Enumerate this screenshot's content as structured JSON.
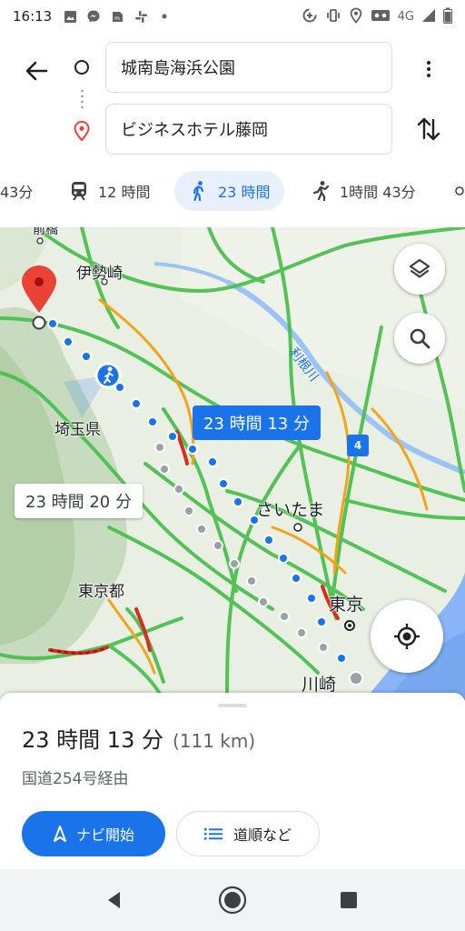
{
  "status_bar": {
    "time": "16:13",
    "network": "4G",
    "left_icons": [
      "image-icon",
      "messenger-icon",
      "sim-icon",
      "slack-icon",
      "dot-icon"
    ],
    "right_icons": [
      "data-saver-icon",
      "vibrate-icon",
      "location-icon",
      "voicemail-icon",
      "signal-icon",
      "battery-icon"
    ]
  },
  "search": {
    "start": "城南島海浜公園",
    "destination": "ビジネスホテル藤岡"
  },
  "modes": [
    {
      "name": "drive",
      "label": "43分",
      "icon": "car-icon",
      "active": false
    },
    {
      "name": "transit",
      "label": "12 時間",
      "icon": "train-icon",
      "active": false
    },
    {
      "name": "walk",
      "label": "23 時間",
      "icon": "walk-icon",
      "active": true
    },
    {
      "name": "ride",
      "label": "1時間 43分",
      "icon": "rideshare-icon",
      "active": false
    }
  ],
  "map": {
    "labels": {
      "top_town": "伊勢崎",
      "saitama_pref": "埼玉県",
      "tokyo_pref": "東京都",
      "saitama_city": "さいたま",
      "tokyo": "東京",
      "kawasaki": "川崎",
      "tone_river": "利根川",
      "route_num": "4",
      "top_edge": "前橋"
    },
    "callouts": {
      "selected": "23 時間 13 分",
      "alternative": "23 時間 20 分"
    }
  },
  "sheet": {
    "duration": "23 時間 13 分",
    "distance": "(111 km)",
    "via": "国道254号経由",
    "start_label": "ナビ開始",
    "steps_label": "道順など"
  },
  "colors": {
    "accent": "#1a73e8",
    "route_alt": "#9aa0a6",
    "traffic_green": "#34c84a",
    "traffic_orange": "#f4a31a",
    "traffic_red": "#e0311f",
    "pin_red": "#ea4335"
  }
}
